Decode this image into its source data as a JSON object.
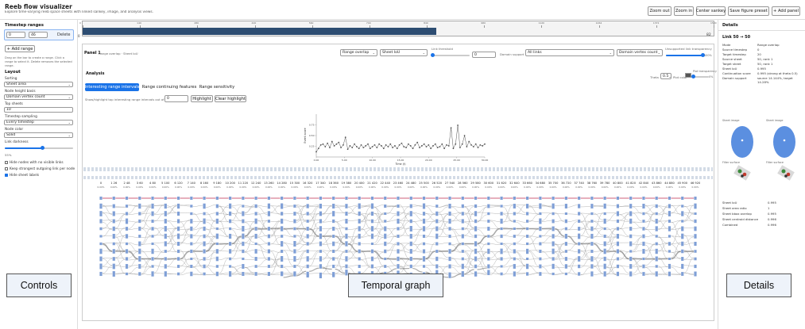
{
  "app": {
    "title": "Reeb flow visualizer",
    "subtitle": "Explore time-varying reeb space sheets with linked sankey, image, and analysis views."
  },
  "toolbar": {
    "zoom_out": "Zoom out",
    "zoom_in": "Zoom in",
    "center_sankey": "Center sankey",
    "save_preset": "Save figure preset",
    "add_panel": "+ Add panel"
  },
  "timeline": {
    "start_label": "0",
    "end_label": "82",
    "ticks": [
      "0",
      "140",
      "280",
      "420",
      "560",
      "700",
      "840",
      "980",
      "1120",
      "1264",
      "1372",
      "1500"
    ],
    "selection_start": 0,
    "selection_end": 46
  },
  "controls": {
    "timestep_ranges_heading": "Timestep ranges",
    "range_start": "0",
    "range_end": "46",
    "delete": "Delete",
    "add_range": "+ Add range",
    "hint": "Drag on the bar to create a range. Click a range to select it. Delete removes the selected range.",
    "layout_heading": "Layout",
    "sorting_label": "Sorting",
    "sorting_value": "Sheet area",
    "node_height_label": "Node height basis",
    "node_height_value": "Domain vertex count",
    "top_sheets_label": "Top sheets",
    "top_sheets_value": "10",
    "timestep_sampling_label": "Timestep sampling",
    "timestep_sampling_value": "Every timestep",
    "node_color_label": "Node color",
    "node_color_value": "Solid",
    "link_darkness_label": "Link darkness",
    "link_darkness_pct": "55%",
    "link_darkness_value": 0.55,
    "checks": [
      {
        "label": "Hide nodes with no visible links",
        "checked": false
      },
      {
        "label": "Keep strongest outgoing link per node",
        "checked": false
      },
      {
        "label": "Hide sheet labels",
        "checked": true
      }
    ]
  },
  "panel": {
    "title": "Panel 1",
    "subtitle": "Range overlap · Sheet IoU",
    "metric_select": "Range overlap",
    "measure_select": "Sheet IoU",
    "link_threshold_label": "Link threshold",
    "link_threshold_value": "0",
    "domain_support_label": "Domain support",
    "domain_support_value": "All links",
    "domain_metric_value": "Domain vertex count",
    "unsupported_label": "Unsupported link transparency",
    "unsupported_pct": "100%",
    "unsupported_value": 1.0
  },
  "analysis": {
    "heading": "Analysis",
    "tabs": [
      "Interesting range intervals",
      "Range continuing features",
      "Range sensitivity"
    ],
    "active_tab": 0,
    "theta_label": "Theta",
    "theta_value": "0.5",
    "plot_color_label": "Plot color",
    "plot_transparency_label": "Plot transparency",
    "plot_transparency_pct": "0%",
    "plot_transparency_value": 0.0,
    "highlight_prompt": "Show/highlight top interesting range intervals out of 82",
    "highlight_value": "0",
    "highlight_button": "Highlight",
    "clear_button": "Clear highlight"
  },
  "chart_data": {
    "type": "line",
    "xlabel": "Time (t)",
    "ylabel": "Event score",
    "xlim": [
      0,
      30
    ],
    "ylim": [
      0,
      1
    ],
    "x_ticks": [
      "0.00",
      "5.00",
      "10.00",
      "15.00",
      "20.00",
      "25.00",
      "30.00"
    ],
    "y_ticks": [
      "0.25",
      "0.50",
      "0.75"
    ],
    "x": [
      0.0,
      0.4,
      0.8,
      1.2,
      1.6,
      2.0,
      2.4,
      2.8,
      3.2,
      3.6,
      4.0,
      4.4,
      4.8,
      5.2,
      5.6,
      6.0,
      6.4,
      6.8,
      7.2,
      7.6,
      8.0,
      8.4,
      8.8,
      9.2,
      9.6,
      10.0,
      10.4,
      10.8,
      11.2,
      11.6,
      12.0,
      12.4,
      12.8,
      13.2,
      13.6,
      14.0,
      14.4,
      14.8,
      15.2,
      15.6,
      16.0,
      16.4,
      16.8,
      17.2,
      17.6,
      18.0,
      18.4,
      18.8,
      19.2,
      19.6,
      20.0,
      20.4,
      20.8,
      21.2,
      21.6,
      22.0,
      22.4,
      22.8,
      23.2,
      23.6,
      24.0,
      24.4,
      24.8,
      25.2,
      25.6,
      26.0,
      26.4,
      26.8,
      27.2,
      27.6,
      28.0,
      28.4,
      28.8,
      29.2,
      29.6,
      30.0
    ],
    "values": [
      0.12,
      0.2,
      0.28,
      0.3,
      0.24,
      0.32,
      0.22,
      0.36,
      0.26,
      0.3,
      0.34,
      0.22,
      0.28,
      0.46,
      0.18,
      0.26,
      0.22,
      0.3,
      0.24,
      0.2,
      0.28,
      0.22,
      0.26,
      0.3,
      0.2,
      0.24,
      0.28,
      0.22,
      0.3,
      0.26,
      0.2,
      0.28,
      0.24,
      0.3,
      0.22,
      0.26,
      0.2,
      0.28,
      0.32,
      0.24,
      0.22,
      0.3,
      0.26,
      0.2,
      0.28,
      0.34,
      0.22,
      0.26,
      0.3,
      0.24,
      0.28,
      0.2,
      0.26,
      0.3,
      0.22,
      0.24,
      0.3,
      0.2,
      0.28,
      0.26,
      0.68,
      0.2,
      0.3,
      0.74,
      0.22,
      0.3,
      0.5,
      0.24,
      0.36,
      0.28,
      0.24,
      0.3,
      0.22,
      0.28,
      0.26,
      0.3
    ]
  },
  "temporal_graph": {
    "column_labels": [
      "0 0.00%",
      "1 26 0.00%",
      "2 48 0.00%",
      "3 60 0.00%",
      "4 80 0.00%",
      "5 100 0.00%",
      "6 120 0.00%",
      "7 140 0.00%",
      "8 160 0.00%",
      "9 180 0.00%",
      "10 200 0.00%",
      "11 220 0.00%",
      "12 240 0.00%",
      "13 260 0.00%",
      "14 280 0.00%",
      "15 300 0.00%",
      "16 320 0.00%",
      "17 340 0.00%",
      "18 360 0.00%",
      "19 380 0.00%",
      "20 400 0.00%",
      "21 420 0.00%",
      "22 440 0.00%",
      "23 460 0.00%",
      "24 480 0.00%",
      "25 500 0.00%",
      "26 520 0.00%",
      "27 540 0.00%",
      "28 560 0.00%",
      "29 580 0.00%",
      "30 600 0.00%",
      "31 620 0.00%",
      "32 640 0.00%",
      "33 660 0.00%",
      "34 680 0.00%",
      "35 700 0.00%",
      "36 720 0.00%",
      "37 740 0.00%",
      "38 760 0.00%",
      "39 780 0.00%",
      "40 800 0.00%",
      "41 820 0.00%",
      "42 840 0.00%",
      "43 860 0.00%",
      "44 880 0.00%",
      "45 900 0.00%",
      "46 920 0.00%"
    ]
  },
  "details": {
    "heading": "Details",
    "link_title": "Link 50 → 50",
    "rows": [
      {
        "k": "Mode",
        "v": "Range overlap"
      },
      {
        "k": "Source timestep",
        "v": "0"
      },
      {
        "k": "Target timestep",
        "v": "20"
      },
      {
        "k": "Source sheet",
        "v": "50, rank 1"
      },
      {
        "k": "Target sheet",
        "v": "50, rank 1"
      },
      {
        "k": "Sheet IoU",
        "v": "0.995"
      },
      {
        "k": "Continuation score",
        "v": "0.995 (strong at theta 0.5)"
      },
      {
        "k": "Domain support",
        "v": "source 14.144%, target 14.28%"
      }
    ],
    "sheet_image_label": "Sheet image",
    "filter_surface_label": "Filter surface",
    "stats": [
      {
        "k": "Sheet IoU",
        "v": "0.995"
      },
      {
        "k": "Sheet area ratio",
        "v": "1"
      },
      {
        "k": "Sheet bbox overlap",
        "v": "0.995"
      },
      {
        "k": "Sheet centroid distance",
        "v": "0.996"
      },
      {
        "k": "Combined",
        "v": "0.996"
      }
    ]
  },
  "callouts": {
    "controls": "Controls",
    "temporal_graph": "Temporal graph",
    "details": "Details"
  },
  "colors": {
    "accent": "#1a73e8",
    "node": "#7f9fd6",
    "link": "#9a9a9a",
    "highlight_link": "#c23b5a",
    "timeline_fill": "#2d4d72"
  }
}
